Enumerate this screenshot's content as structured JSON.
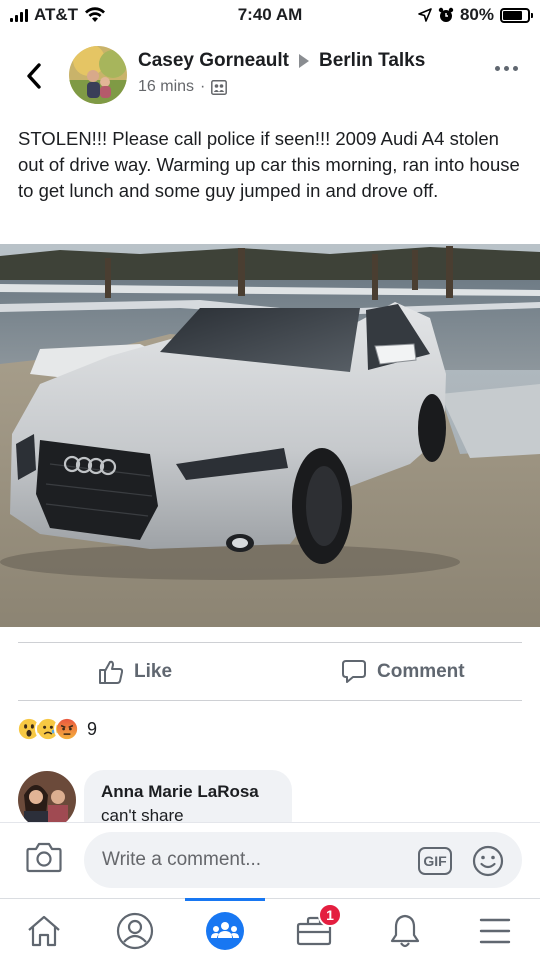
{
  "status_bar": {
    "carrier": "AT&T",
    "time": "7:40 AM",
    "battery": "80%",
    "battery_level": 0.8
  },
  "post": {
    "author": "Casey Gorneault",
    "group": "Berlin Talks",
    "time_ago": "16 mins",
    "separator": "·",
    "audience_icon": "group-icon",
    "text": "STOLEN!!! Please call police if seen!!! 2009 Audi A4 stolen out of drive way. Warming up car this morning, ran into house to get lunch and some guy jumped in and drove off."
  },
  "actions": {
    "like_label": "Like",
    "comment_label": "Comment"
  },
  "reactions": {
    "types": [
      "wow",
      "sad",
      "angry"
    ],
    "count": "9"
  },
  "comments": [
    {
      "author": "Anna Marie LaRosa",
      "text": "can't share"
    }
  ],
  "composer": {
    "placeholder": "Write a comment...",
    "gif_label": "GIF"
  },
  "tab_bar": {
    "items": [
      "home",
      "profile",
      "groups",
      "marketplace",
      "notifications",
      "menu"
    ],
    "active": "groups",
    "marketplace_badge": "1"
  },
  "colors": {
    "accent": "#1877f2",
    "badge": "#e41e3f",
    "secondary_text": "#65676b"
  }
}
